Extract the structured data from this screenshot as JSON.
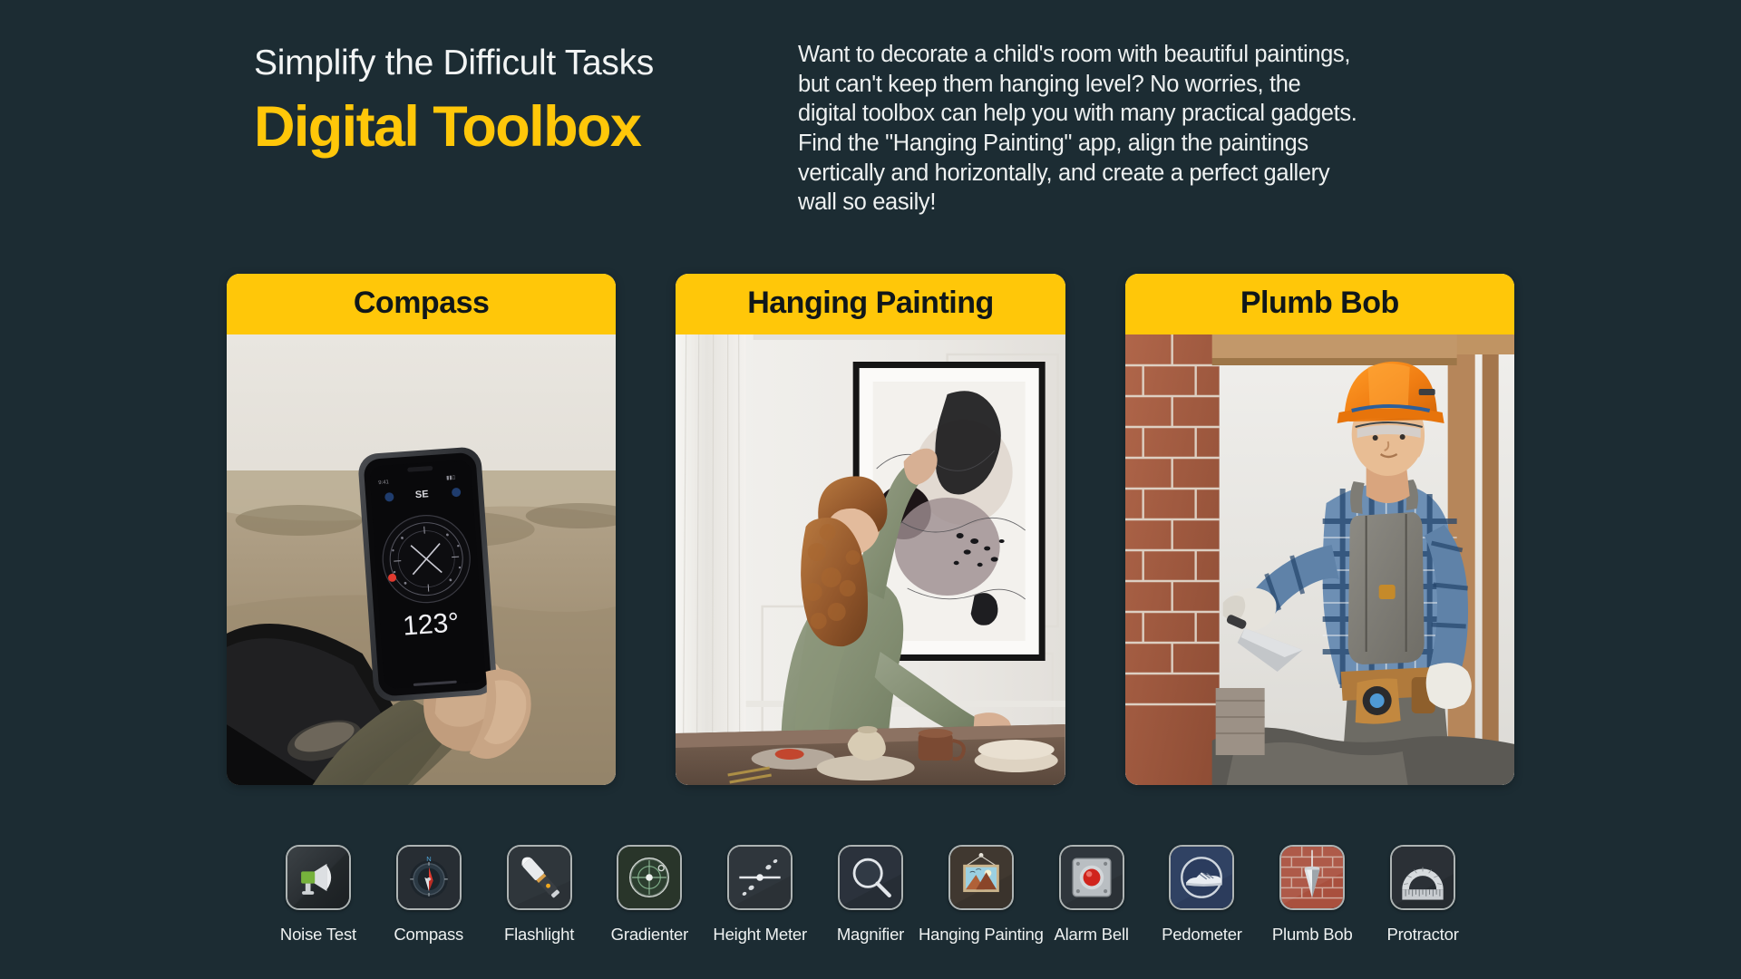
{
  "theme": {
    "background": "#1c2c33",
    "accent_yellow": "#ffc709",
    "text_light": "#eef1f1",
    "title_dark": "#10171a"
  },
  "header": {
    "eyebrow": "Simplify the Difficult Tasks",
    "headline": "Digital Toolbox",
    "paragraph": "Want to decorate a child's room with beautiful paintings, but can't keep them hanging level? No worries, the digital toolbox can help you with many practical gadgets. Find the \"Hanging Painting\" app, align the paintings vertically and horizontally, and create a perfect gallery wall so easily!"
  },
  "cards": [
    {
      "title": "Compass",
      "media_name": "compass-photo",
      "photo_description": "Hand holding a smartphone out of a car window in a desert, screen shows a compass app",
      "phone_screen": {
        "direction": "SE",
        "bearing": "123°"
      }
    },
    {
      "title": "Hanging Painting",
      "media_name": "hanging-painting-photo",
      "photo_description": "Woman in olive shirt hanging a large framed abstract art print on a white wall above a wooden table"
    },
    {
      "title": "Plumb Bob",
      "media_name": "plumb-bob-photo",
      "photo_description": "Construction worker in orange hard hat and plaid shirt laying bricks with a trowel"
    }
  ],
  "app_icons": [
    {
      "label": "Noise Test",
      "icon": "megaphone-icon"
    },
    {
      "label": "Compass",
      "icon": "compass-icon"
    },
    {
      "label": "Flashlight",
      "icon": "flashlight-icon"
    },
    {
      "label": "Gradienter",
      "icon": "gradienter-icon"
    },
    {
      "label": "Height Meter",
      "icon": "height-meter-icon"
    },
    {
      "label": "Magnifier",
      "icon": "magnifier-icon"
    },
    {
      "label": "Hanging Painting",
      "icon": "framed-picture-icon"
    },
    {
      "label": "Alarm Bell",
      "icon": "alarm-bell-icon"
    },
    {
      "label": "Pedometer",
      "icon": "sneaker-icon"
    },
    {
      "label": "Plumb Bob",
      "icon": "plumb-bob-icon"
    },
    {
      "label": "Protractor",
      "icon": "protractor-icon"
    }
  ]
}
